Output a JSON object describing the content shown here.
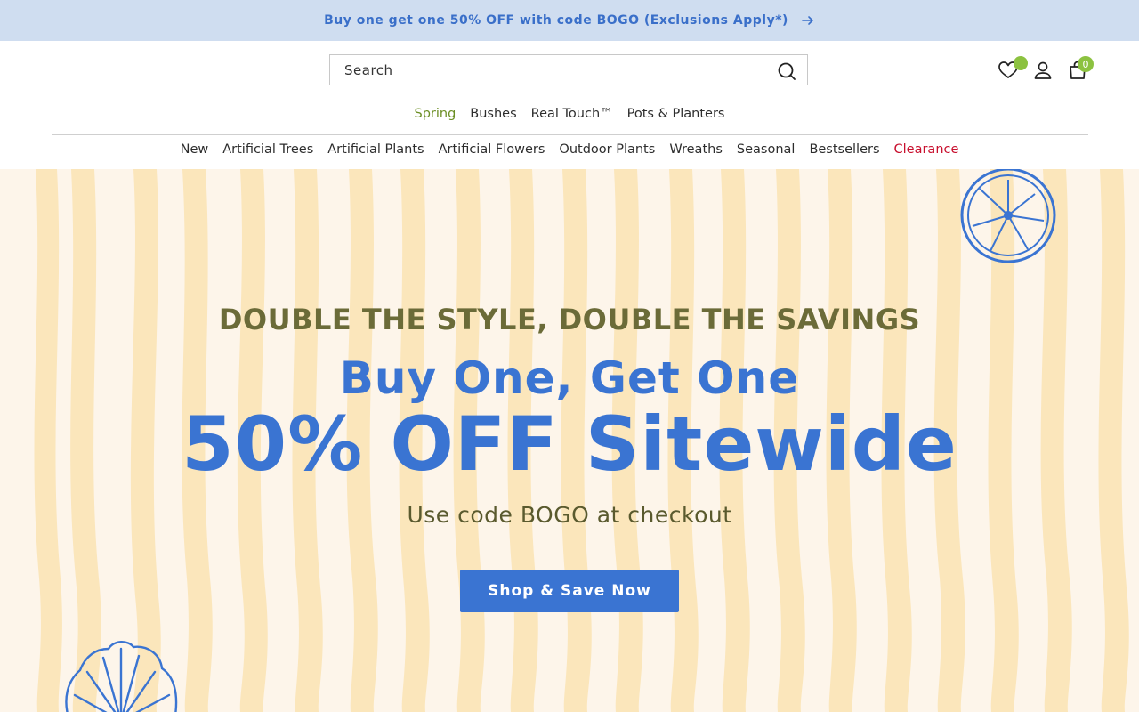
{
  "promo": {
    "text": "Buy one get one 50% OFF with code BOGO (Exclusions Apply*)",
    "arrow_icon": "arrow-right-icon"
  },
  "search": {
    "placeholder": "Search",
    "icon": "search-icon"
  },
  "header_icons": {
    "wishlist": "heart-icon",
    "account": "user-icon",
    "cart": "shopping-bag-icon",
    "cart_count": "0"
  },
  "sub_nav": [
    {
      "label": "Spring",
      "color": "#6b8e23"
    },
    {
      "label": "Bushes"
    },
    {
      "label": "Real Touch™"
    },
    {
      "label": "Pots & Planters"
    }
  ],
  "main_nav": [
    {
      "label": "New"
    },
    {
      "label": "Artificial Trees"
    },
    {
      "label": "Artificial Plants"
    },
    {
      "label": "Artificial Flowers"
    },
    {
      "label": "Outdoor Plants"
    },
    {
      "label": "Wreaths"
    },
    {
      "label": "Seasonal"
    },
    {
      "label": "Bestsellers"
    },
    {
      "label": "Clearance",
      "color": "#c8102e"
    }
  ],
  "hero": {
    "eyebrow": "DOUBLE THE STYLE, DOUBLE THE SAVINGS",
    "headline1": "Buy One, Get One",
    "headline2": "50% OFF Sitewide",
    "subline": "Use code BOGO at checkout",
    "cta_label": "Shop & Save Now",
    "decor": [
      "citrus-slice-icon",
      "seashell-icon"
    ]
  },
  "colors": {
    "promo_bg": "#cfddf0",
    "accent_blue": "#3a74d2",
    "olive": "#6b6b38",
    "badge_green": "#8cc240",
    "stripe": "#fbe6bb"
  }
}
